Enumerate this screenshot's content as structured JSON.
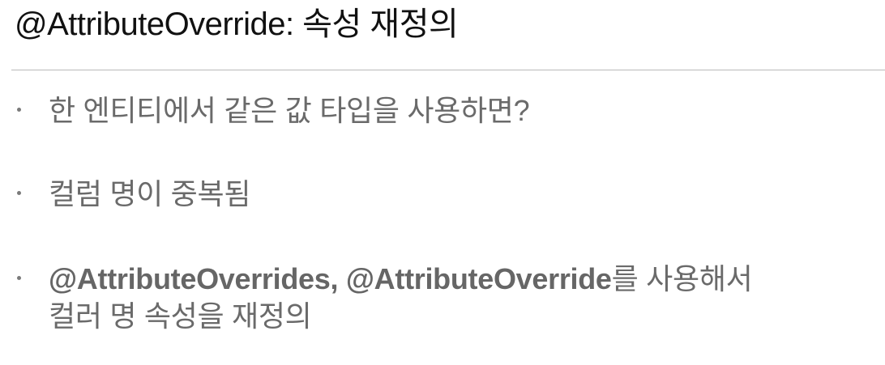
{
  "slide": {
    "title": "@AttributeOverride: 속성 재정의",
    "bullets": [
      {
        "text": "한 엔티티에서 같은 값 타입을 사용하면?"
      },
      {
        "text": "컬럼 명이 중복됨"
      },
      {
        "bold": "@AttributeOverrides, @AttributeOverride",
        "rest": "를 사용해서",
        "line2": "컬러 명 속성을 재정의"
      }
    ]
  }
}
